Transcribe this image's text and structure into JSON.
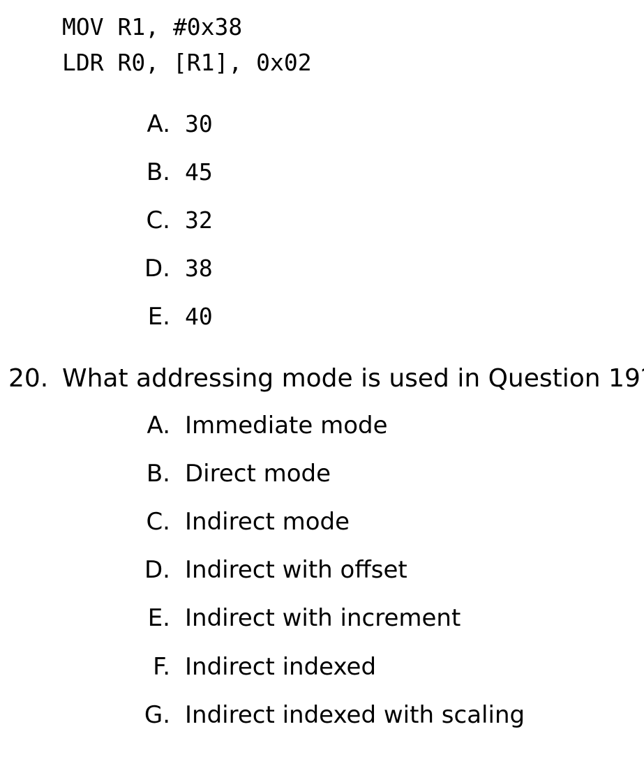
{
  "code": {
    "line1": "MOV R1, #0x38",
    "line2": "LDR R0, [R1], 0x02"
  },
  "q19_options": [
    {
      "letter": "A.",
      "text": "30"
    },
    {
      "letter": "B.",
      "text": "45"
    },
    {
      "letter": "C.",
      "text": "32"
    },
    {
      "letter": "D.",
      "text": "38"
    },
    {
      "letter": "E.",
      "text": "40"
    }
  ],
  "q20": {
    "number": "20.",
    "text": "What addressing mode is used in Question 19?",
    "options": [
      {
        "letter": "A.",
        "text": "Immediate mode"
      },
      {
        "letter": "B.",
        "text": "Direct mode"
      },
      {
        "letter": "C.",
        "text": "Indirect mode"
      },
      {
        "letter": "D.",
        "text": "Indirect with offset"
      },
      {
        "letter": "E.",
        "text": "Indirect with increment"
      },
      {
        "letter": "F.",
        "text": "Indirect indexed"
      },
      {
        "letter": "G.",
        "text": "Indirect indexed with scaling"
      }
    ]
  }
}
